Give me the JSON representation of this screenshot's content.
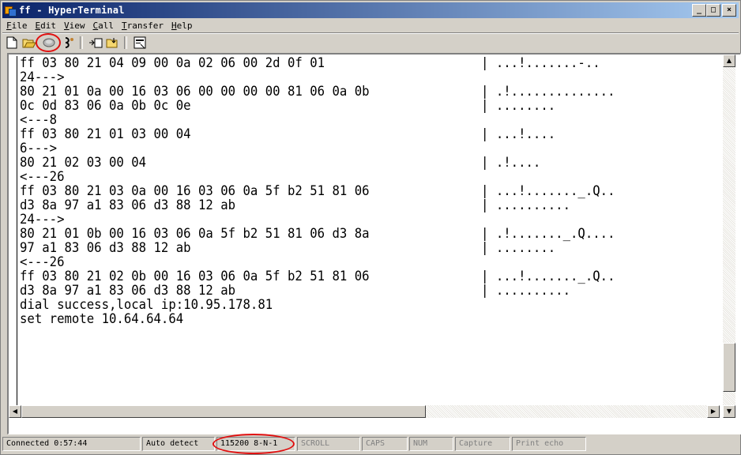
{
  "window": {
    "title": "ff - HyperTerminal",
    "controls": {
      "minimize": "_",
      "maximize": "□",
      "close": "×"
    }
  },
  "menu": {
    "items": [
      {
        "label": "File",
        "key": "F",
        "rest": "ile"
      },
      {
        "label": "Edit",
        "key": "E",
        "rest": "dit"
      },
      {
        "label": "View",
        "key": "V",
        "rest": "iew"
      },
      {
        "label": "Call",
        "key": "C",
        "rest": "all"
      },
      {
        "label": "Transfer",
        "key": "T",
        "rest": "ransfer"
      },
      {
        "label": "Help",
        "key": "H",
        "rest": "elp"
      }
    ]
  },
  "toolbar": {
    "buttons": [
      "new-icon",
      "open-icon",
      "connect-icon",
      "disconnect-icon",
      "send-icon",
      "receive-icon",
      "properties-icon"
    ],
    "highlight_color": "#e01010"
  },
  "terminal": {
    "lines": [
      {
        "hex": "ff 03 80 21 04 09 00 0a 02 06 00 2d 0f 01",
        "ascii": "| ...!.......-.."
      },
      {
        "hex": "24--->",
        "ascii": ""
      },
      {
        "hex": "80 21 01 0a 00 16 03 06 00 00 00 00 81 06 0a 0b",
        "ascii": "| .!.............."
      },
      {
        "hex": "0c 0d 83 06 0a 0b 0c 0e",
        "ascii": "| ........"
      },
      {
        "hex": "<---8",
        "ascii": ""
      },
      {
        "hex": "ff 03 80 21 01 03 00 04",
        "ascii": "| ...!...."
      },
      {
        "hex": "6--->",
        "ascii": ""
      },
      {
        "hex": "80 21 02 03 00 04",
        "ascii": "| .!...."
      },
      {
        "hex": "<---26",
        "ascii": ""
      },
      {
        "hex": "ff 03 80 21 03 0a 00 16 03 06 0a 5f b2 51 81 06",
        "ascii": "| ...!......._.Q.."
      },
      {
        "hex": "d3 8a 97 a1 83 06 d3 88 12 ab",
        "ascii": "| .........."
      },
      {
        "hex": "24--->",
        "ascii": ""
      },
      {
        "hex": "80 21 01 0b 00 16 03 06 0a 5f b2 51 81 06 d3 8a",
        "ascii": "| .!......._.Q...."
      },
      {
        "hex": "97 a1 83 06 d3 88 12 ab",
        "ascii": "| ........"
      },
      {
        "hex": "<---26",
        "ascii": ""
      },
      {
        "hex": "ff 03 80 21 02 0b 00 16 03 06 0a 5f b2 51 81 06",
        "ascii": "| ...!......._.Q.."
      },
      {
        "hex": "d3 8a 97 a1 83 06 d3 88 12 ab",
        "ascii": "| .........."
      },
      {
        "hex": "dial success,local ip:10.95.178.81",
        "ascii": ""
      },
      {
        "hex": "set remote 10.64.64.64",
        "ascii": ""
      }
    ]
  },
  "statusbar": {
    "connected": "Connected 0:57:44",
    "detect": "Auto detect",
    "port_settings": "115200 8-N-1",
    "scroll": "SCROLL",
    "caps": "CAPS",
    "num": "NUM",
    "capture": "Capture",
    "print_echo": "Print echo"
  }
}
